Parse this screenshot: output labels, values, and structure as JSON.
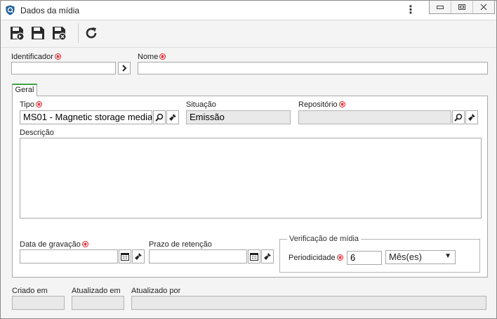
{
  "window": {
    "title": "Dados da mídia",
    "menu_icon": "kebab-menu-icon",
    "controls": [
      "minimize-icon",
      "restore-icon",
      "close-icon"
    ]
  },
  "toolbar": {
    "buttons": [
      {
        "name": "save-and-new-button",
        "icon": "floppy-arrow-icon"
      },
      {
        "name": "save-button",
        "icon": "floppy-icon"
      },
      {
        "name": "save-and-close-button",
        "icon": "floppy-close-icon"
      },
      {
        "name": "refresh-button",
        "icon": "refresh-icon"
      }
    ]
  },
  "header_fields": {
    "identificador": {
      "label": "Identificador",
      "value": ""
    },
    "nome": {
      "label": "Nome",
      "value": ""
    }
  },
  "tabs": [
    {
      "label": "Geral",
      "active": true
    }
  ],
  "geral": {
    "tipo": {
      "label": "Tipo",
      "value": "MS01 - Magnetic storage media"
    },
    "situacao": {
      "label": "Situação",
      "value": "Emissão"
    },
    "repositorio": {
      "label": "Repositório",
      "value": ""
    },
    "descricao": {
      "label": "Descrição",
      "value": ""
    },
    "data_gravacao": {
      "label": "Data de gravação",
      "value": ""
    },
    "prazo_retencao": {
      "label": "Prazo de retenção",
      "value": ""
    },
    "verificacao": {
      "legend": "Verificação de mídia",
      "periodicidade_label": "Periodicidade",
      "periodicidade_value": "6",
      "unit_selected": "Mês(es)"
    }
  },
  "footer": {
    "criado_em": {
      "label": "Criado em",
      "value": ""
    },
    "atualizado_em": {
      "label": "Atualizado em",
      "value": ""
    },
    "atualizado_por": {
      "label": "Atualizado por",
      "value": ""
    }
  },
  "colors": {
    "required": "#d9242b",
    "tab_accent": "#3aa346",
    "app_icon": "#1f5f9e"
  }
}
